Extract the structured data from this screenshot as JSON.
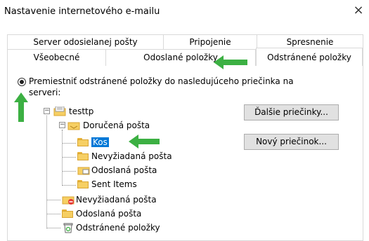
{
  "dialog": {
    "title": "Nastavenie internetového e-mailu",
    "close_glyph": "×"
  },
  "tabs_row1": [
    "Server odosielanej pošty",
    "Pripojenie",
    "Spresnenie"
  ],
  "tabs_row2": [
    "Všeobecné",
    "Odoslané položky",
    "Odstránené položky"
  ],
  "option": {
    "label": "Premiestniť odstránené položky do nasledujúceho priečinka na serveri:"
  },
  "buttons": {
    "more_folders": "Ďalšie priečinky...",
    "new_folder": "Nový priečinok..."
  },
  "tree": {
    "root": "testtp",
    "inbox": "Doručená pošta",
    "kos": "Kos",
    "inbox_junk": "Nevyžiadaná pošta",
    "inbox_sent": "Odoslaná pošta",
    "inbox_sent_items": "Sent Items",
    "junk": "Nevyžiadaná pošta",
    "sent": "Odoslaná pošta",
    "deleted": "Odstránené položky"
  },
  "colors": {
    "accent_arrow": "#3cb043",
    "selection": "#0078d7"
  }
}
